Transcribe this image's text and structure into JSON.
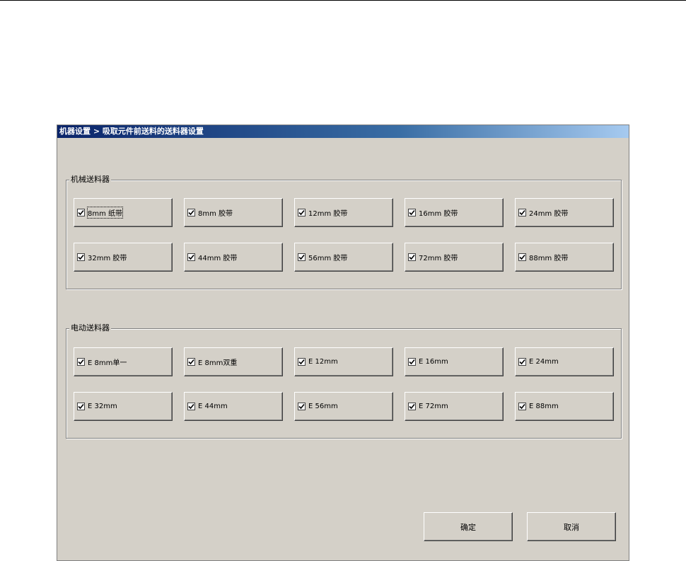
{
  "window": {
    "title": "机器设置 > 吸取元件前送料的送料器设置"
  },
  "mechanical": {
    "label": "机械送料器",
    "items": [
      {
        "label": "8mm 纸带",
        "checked": true
      },
      {
        "label": "8mm 胶带",
        "checked": true
      },
      {
        "label": "12mm 胶带",
        "checked": true
      },
      {
        "label": "16mm 胶带",
        "checked": true
      },
      {
        "label": "24mm 胶带",
        "checked": true
      },
      {
        "label": "32mm 胶带",
        "checked": true
      },
      {
        "label": "44mm 胶带",
        "checked": true
      },
      {
        "label": "56mm 胶带",
        "checked": true
      },
      {
        "label": "72mm 胶带",
        "checked": true
      },
      {
        "label": "88mm 胶带",
        "checked": true
      }
    ]
  },
  "electric": {
    "label": "电动送料器",
    "items": [
      {
        "label": "E 8mm单一",
        "checked": true
      },
      {
        "label": "E 8mm双重",
        "checked": true
      },
      {
        "label": "E 12mm",
        "checked": true
      },
      {
        "label": "E 16mm",
        "checked": true
      },
      {
        "label": "E 24mm",
        "checked": true
      },
      {
        "label": "E 32mm",
        "checked": true
      },
      {
        "label": "E 44mm",
        "checked": true
      },
      {
        "label": "E 56mm",
        "checked": true
      },
      {
        "label": "E 72mm",
        "checked": true
      },
      {
        "label": "E 88mm",
        "checked": true
      }
    ]
  },
  "buttons": {
    "ok": "确定",
    "cancel": "取消"
  },
  "icons": {
    "checkbox": "checkmark-icon"
  }
}
